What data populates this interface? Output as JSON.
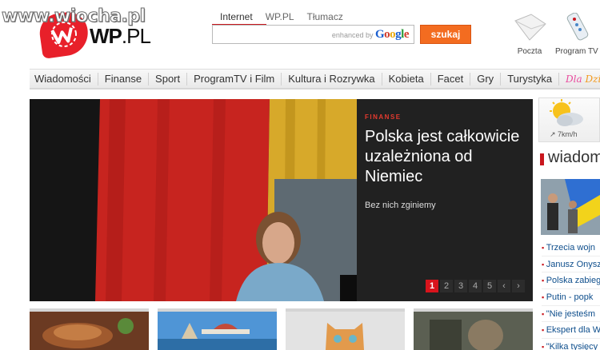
{
  "watermark": "www.wiocha.pl",
  "logo": {
    "text": "WP",
    "suffix": ".PL"
  },
  "search": {
    "tabs": [
      "Internet",
      "WP.PL",
      "Tłumacz"
    ],
    "placeholder": "",
    "google_prefix": "enhanced by",
    "google_word": "Google",
    "button_label": "szukaj"
  },
  "top_icons": [
    {
      "icon": "mail-envelope-icon",
      "label": "Poczta"
    },
    {
      "icon": "tv-remote-icon",
      "label": "Program TV"
    }
  ],
  "nav": {
    "items": [
      "Wiadomości",
      "Finanse",
      "Sport",
      "ProgramTV i Film",
      "Kultura i Rozrywka",
      "Kobieta",
      "Facet",
      "Gry",
      "Turystyka"
    ],
    "kids": [
      "Dla",
      " ",
      "Dzie",
      "ci"
    ]
  },
  "hero": {
    "category": "FINANSE",
    "headline": "Polska jest całkowicie uzależniona od Niemiec",
    "lead": "Bez nich zginiemy",
    "pages": [
      "1",
      "2",
      "3",
      "4",
      "5"
    ],
    "prev": "‹",
    "next": "›",
    "active_page": "1"
  },
  "weather": {
    "icon": "sun-cloud-icon",
    "wind": "7km/h"
  },
  "side": {
    "title": "wiadom",
    "items": [
      "Trzecia wojn",
      "Janusz Onysz",
      "Polska zabieg",
      "Putin - popk",
      "\"Nie jesteśm",
      "Ekspert dla W",
      "\"Kilka tysięcy"
    ]
  },
  "colors": {
    "accent": "#c9171e",
    "search_button": "#f36c20",
    "link": "#0e4e8c"
  }
}
